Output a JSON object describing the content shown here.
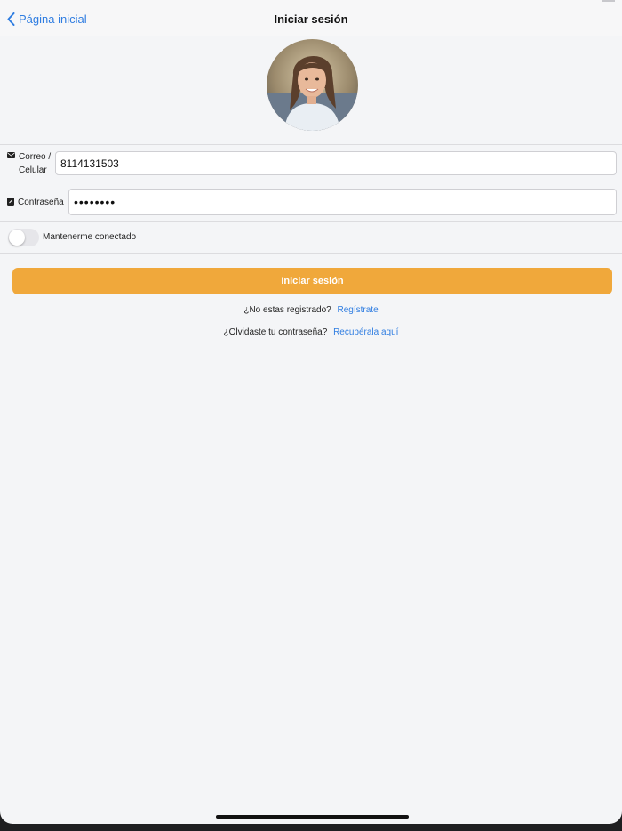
{
  "navbar": {
    "back_label": "Página inicial",
    "title": "Iniciar sesión"
  },
  "form": {
    "email_label": "Correo / Celular",
    "email_label_line1": "Correo /",
    "email_label_line2": "Celular",
    "email_value": "8114131503",
    "email_icon": "envelope-icon",
    "password_label": "Contraseña",
    "password_value": "••••••••",
    "password_icon": "lock-icon",
    "remember_label": "Mantenerme conectado",
    "remember_on": false
  },
  "actions": {
    "login_label": "Iniciar sesión",
    "register_prompt": "¿No estas registrado?",
    "register_link": "Regístrate",
    "forgot_prompt": "¿Olvidaste tu contraseña?",
    "forgot_link": "Recupérala aquí"
  },
  "colors": {
    "accent": "#2f7de1",
    "button": "#f0a83b",
    "background": "#f4f5f7"
  }
}
